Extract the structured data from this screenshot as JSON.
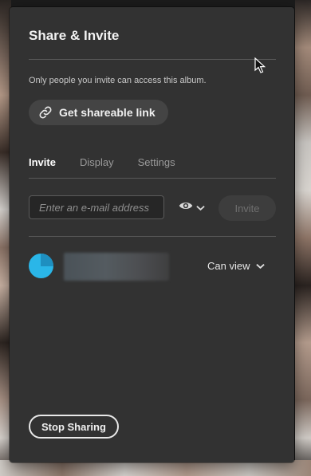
{
  "panel": {
    "title": "Share & Invite",
    "note": "Only people you invite can access this album.",
    "shareable_link_label": "Get shareable link"
  },
  "tabs": [
    {
      "label": "Invite",
      "active": true
    },
    {
      "label": "Display",
      "active": false
    },
    {
      "label": "Settings",
      "active": false
    }
  ],
  "invite_form": {
    "email_placeholder": "Enter an e-mail address",
    "permission_icon": "eye-icon",
    "invite_label": "Invite"
  },
  "members": [
    {
      "role": "Can view",
      "avatar_color": "#2ab6e8"
    }
  ],
  "footer": {
    "stop_sharing_label": "Stop Sharing"
  },
  "colors": {
    "panel_bg": "#323232",
    "accent": "#2ab6e8"
  }
}
